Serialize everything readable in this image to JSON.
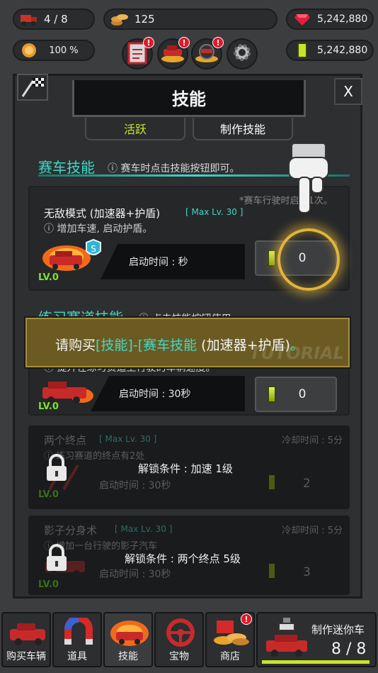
{
  "top": {
    "cars": "4 / 8",
    "coins": "125",
    "rubies": "5,242,880",
    "bonus": "100 %",
    "cash": "5,242,880"
  },
  "badges": {
    "alert": "!"
  },
  "panel": {
    "title": "技能",
    "close": "X",
    "tabs": {
      "active": "活跃",
      "craft": "制作技能"
    }
  },
  "race_section": {
    "title": "赛车技能",
    "hint": "ⓘ 赛车时点击技能按钮即可。",
    "note": "*赛车行驶时启用1次。"
  },
  "skill1": {
    "name": "无敌模式 (加速器+护盾)",
    "max": "[ Max Lv. 30 ]",
    "desc": "ⓘ 增加车速, 启动护盾。",
    "lv": "LV.0",
    "time": "启动时间 : 秒",
    "cost": "0"
  },
  "practice_section": {
    "title": "练习赛道技能",
    "hint": "ⓘ 点击技能按钮使用"
  },
  "tutorial": {
    "prefix": "请购买",
    "highlight": "[技能]-[赛车技能",
    "suffix": " (加速器+护盾)",
    "end": "。",
    "watermark": "TUTORIAL"
  },
  "skill2": {
    "desc": "ⓘ 提升在练习赛道上行驶的车辆速度。",
    "lv": "LV.0",
    "time": "启动时间 : 30秒",
    "cost": "0"
  },
  "skill3": {
    "name": "两个终点",
    "max": "[ Max Lv. 30 ]",
    "desc": "ⓘ 练习赛道的终点有2处",
    "cooldown": "冷却时间 : 5分",
    "lv": "LV.0",
    "time": "启动时间 : 30秒",
    "cost": "2",
    "unlock": "解锁条件 : 加速 1级"
  },
  "skill4": {
    "name": "影子分身术",
    "max": "[ Max Lv. 30 ]",
    "desc": "ⓘ 增加一台行驶的影子汽车",
    "cooldown": "冷却时间 : 5分",
    "lv": "LV.0",
    "time": "启动时间 : 30秒",
    "cost": "3",
    "unlock": "解锁条件 : 两个终点 5级"
  },
  "nav": {
    "buy": "购买车辆",
    "items": "道具",
    "skills": "技能",
    "treasure": "宝物",
    "shop": "商店",
    "craft": "制作迷你车",
    "craft_count": "8 / 8"
  },
  "colors": {
    "accent": "#3fd9c8",
    "gem": "#c9e32a",
    "tutorial_bg": "#6b5b22"
  }
}
